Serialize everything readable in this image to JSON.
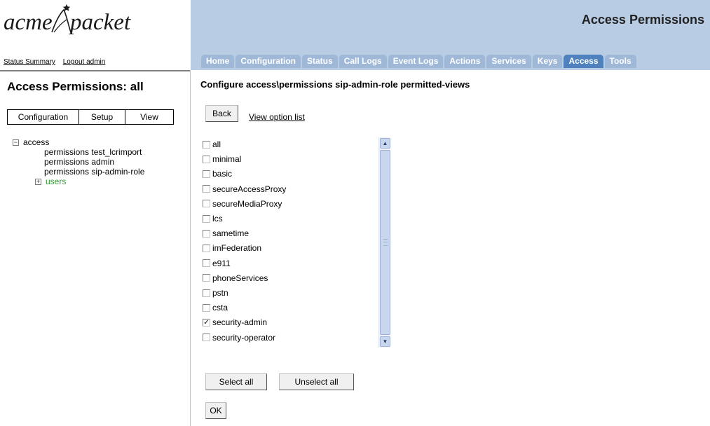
{
  "brand": {
    "word1": "acme",
    "word2": "packet"
  },
  "header": {
    "links": [
      "Status Summary",
      "Logout admin"
    ],
    "page_title": "Access Permissions"
  },
  "tabs": [
    {
      "label": "Home",
      "active": false
    },
    {
      "label": "Configuration",
      "active": false
    },
    {
      "label": "Status",
      "active": false
    },
    {
      "label": "Call Logs",
      "active": false
    },
    {
      "label": "Event Logs",
      "active": false
    },
    {
      "label": "Actions",
      "active": false
    },
    {
      "label": "Services",
      "active": false
    },
    {
      "label": "Keys",
      "active": false
    },
    {
      "label": "Access",
      "active": true
    },
    {
      "label": "Tools",
      "active": false
    }
  ],
  "sidebar": {
    "title": "Access Permissions: all",
    "mode_tabs": [
      "Configuration",
      "Setup",
      "View"
    ],
    "tree": {
      "root": {
        "toggle": "−",
        "label": "access"
      },
      "children": [
        "permissions test_lcrimport",
        "permissions admin",
        "permissions sip-admin-role"
      ],
      "users": {
        "toggle": "+",
        "label": "users"
      }
    }
  },
  "main": {
    "title": "Configure access\\permissions sip-admin-role permitted-views",
    "back_label": "Back",
    "view_option_list_label": "View option list",
    "options": [
      {
        "label": "all",
        "checked": false
      },
      {
        "label": "minimal",
        "checked": false
      },
      {
        "label": "basic",
        "checked": false
      },
      {
        "label": "secureAccessProxy",
        "checked": false
      },
      {
        "label": "secureMediaProxy",
        "checked": false
      },
      {
        "label": "lcs",
        "checked": false
      },
      {
        "label": "sametime",
        "checked": false
      },
      {
        "label": "imFederation",
        "checked": false
      },
      {
        "label": "e911",
        "checked": false
      },
      {
        "label": "phoneServices",
        "checked": false
      },
      {
        "label": "pstn",
        "checked": false
      },
      {
        "label": "csta",
        "checked": false
      },
      {
        "label": "security-admin",
        "checked": true
      },
      {
        "label": "security-operator",
        "checked": false
      }
    ],
    "select_all_label": "Select all",
    "unselect_all_label": "Unselect all",
    "ok_label": "OK"
  },
  "icons": {
    "scroll_up": "up-arrow-icon",
    "scroll_down": "down-arrow-icon",
    "checkmark": "check-icon"
  }
}
